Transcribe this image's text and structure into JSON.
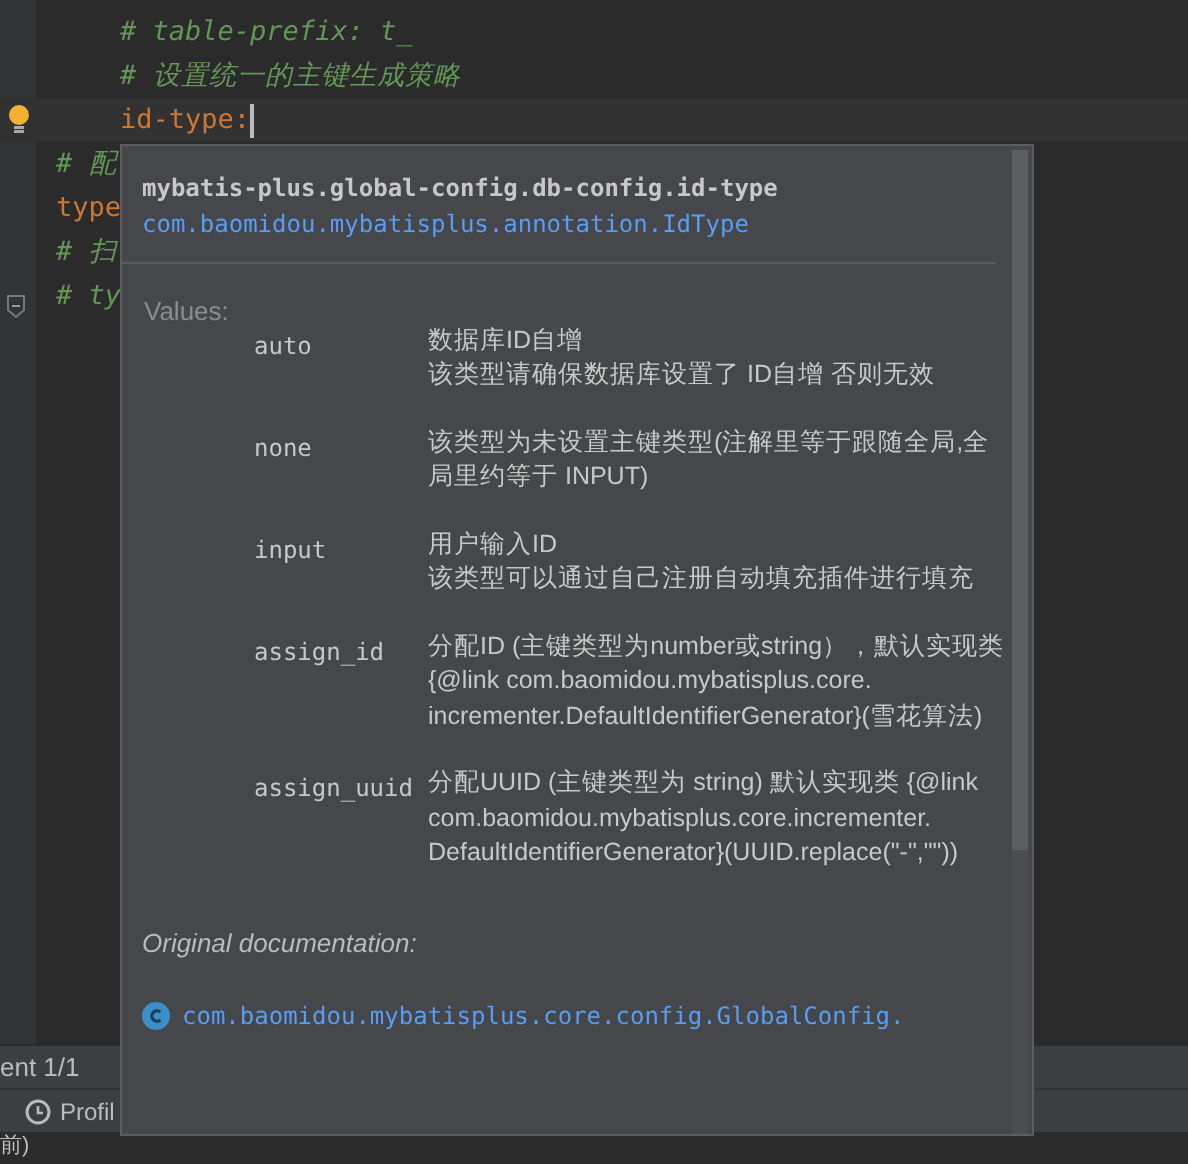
{
  "editor": {
    "lines": [
      {
        "text": "# table-prefix: t_",
        "kind": "comment",
        "nested": true,
        "current": false
      },
      {
        "text": "# 设置统一的主键生成策略",
        "kind": "comment",
        "nested": true,
        "current": false
      },
      {
        "text": "id-type: ",
        "kind": "key",
        "nested": true,
        "current": true
      },
      {
        "text": "# 配",
        "kind": "comment",
        "nested": false,
        "current": false
      },
      {
        "text": "type",
        "kind": "key",
        "nested": false,
        "current": false
      },
      {
        "text": "# 扫",
        "kind": "comment",
        "nested": false,
        "current": false
      },
      {
        "text": "# ty",
        "kind": "comment",
        "nested": false,
        "current": false
      }
    ]
  },
  "popup": {
    "title": "mybatis-plus.global-config.db-config.id-type",
    "type_link": "com.baomidou.mybatisplus.annotation.IdType",
    "values_label": "Values:",
    "values": [
      {
        "name": "auto",
        "description_lines": [
          "数据库ID自增",
          "该类型请确保数据库设置了 ID自增 否则无效"
        ]
      },
      {
        "name": "none",
        "description": "该类型为未设置主键类型(注解里等于跟随全局,全局里约等于 INPUT)"
      },
      {
        "name": "input",
        "description_lines": [
          "用户输入ID",
          "该类型可以通过自己注册自动填充插件进行填充"
        ]
      },
      {
        "name": "assign_id",
        "description": "分配ID (主键类型为number或string），默认实现类 {@link com.baomidou.mybatisplus.core.incrementer.DefaultIdentifierGenerator}(雪花算法)"
      },
      {
        "name": "assign_uuid",
        "description": "分配UUID (主键类型为 string) 默认实现类 {@link com.baomidou.mybatisplus.core.incrementer.DefaultIdentifierGenerator}(UUID.replace(\"-\",\"\"))"
      }
    ],
    "original_doc_label": "Original documentation:",
    "doc_link": "com.baomidou.mybatisplus.core.config.GlobalConfig."
  },
  "bottom": {
    "breadcrumb": "ent 1/1",
    "tool_tab": "Profil",
    "status": "前)"
  }
}
